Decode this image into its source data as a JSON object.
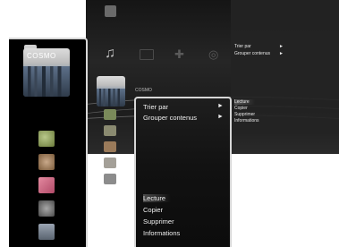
{
  "folder": {
    "label": "COSMO",
    "small_label": "COSMO"
  },
  "small_options": [
    {
      "label": "Trier par",
      "arrow": "►"
    },
    {
      "label": "Grouper contenus",
      "arrow": "►"
    }
  ],
  "small_menu": [
    "Lecture",
    "Copier",
    "Supprimer",
    "Informations"
  ],
  "main_options": [
    {
      "label": "Trier par",
      "arrow": "►"
    },
    {
      "label": "Grouper contenus",
      "arrow": "►"
    }
  ],
  "main_menu": [
    "Lecture",
    "Copier",
    "Supprimer",
    "Informations"
  ],
  "selected_item": "Lecture",
  "icons": {
    "photo": "photo-icon",
    "music": "music-icon",
    "video": "video-icon",
    "game": "game-icon",
    "network": "network-icon"
  },
  "colors": {
    "background": "#000000",
    "border": "#d6d6d6",
    "text": "#f0f0f0"
  }
}
